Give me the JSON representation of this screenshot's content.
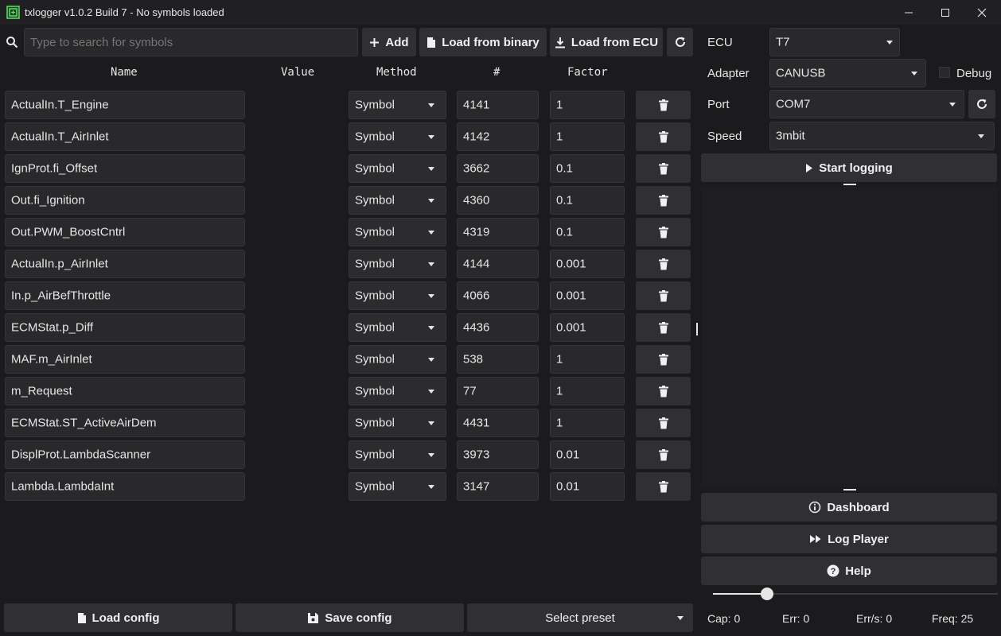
{
  "window": {
    "title": "txlogger v1.0.2 Build 7 - No symbols loaded"
  },
  "toolbar": {
    "search_placeholder": "Type to search for symbols",
    "add_label": "Add",
    "load_binary_label": "Load from binary",
    "load_ecu_label": "Load from ECU"
  },
  "table": {
    "headers": {
      "name": "Name",
      "value": "Value",
      "method": "Method",
      "number": "#",
      "factor": "Factor"
    },
    "rows": [
      {
        "name": "ActualIn.T_Engine",
        "value": "",
        "method": "Symbol",
        "number": "4141",
        "factor": "1"
      },
      {
        "name": "ActualIn.T_AirInlet",
        "value": "",
        "method": "Symbol",
        "number": "4142",
        "factor": "1"
      },
      {
        "name": "IgnProt.fi_Offset",
        "value": "",
        "method": "Symbol",
        "number": "3662",
        "factor": "0.1"
      },
      {
        "name": "Out.fi_Ignition",
        "value": "",
        "method": "Symbol",
        "number": "4360",
        "factor": "0.1"
      },
      {
        "name": "Out.PWM_BoostCntrl",
        "value": "",
        "method": "Symbol",
        "number": "4319",
        "factor": "0.1"
      },
      {
        "name": "ActualIn.p_AirInlet",
        "value": "",
        "method": "Symbol",
        "number": "4144",
        "factor": "0.001"
      },
      {
        "name": "In.p_AirBefThrottle",
        "value": "",
        "method": "Symbol",
        "number": "4066",
        "factor": "0.001"
      },
      {
        "name": "ECMStat.p_Diff",
        "value": "",
        "method": "Symbol",
        "number": "4436",
        "factor": "0.001"
      },
      {
        "name": "MAF.m_AirInlet",
        "value": "",
        "method": "Symbol",
        "number": "538",
        "factor": "1"
      },
      {
        "name": "m_Request",
        "value": "",
        "method": "Symbol",
        "number": "77",
        "factor": "1"
      },
      {
        "name": "ECMStat.ST_ActiveAirDem",
        "value": "",
        "method": "Symbol",
        "number": "4431",
        "factor": "1"
      },
      {
        "name": "DisplProt.LambdaScanner",
        "value": "",
        "method": "Symbol",
        "number": "3973",
        "factor": "0.01"
      },
      {
        "name": "Lambda.LambdaInt",
        "value": "",
        "method": "Symbol",
        "number": "3147",
        "factor": "0.01"
      }
    ]
  },
  "bottom": {
    "load_config_label": "Load config",
    "save_config_label": "Save config",
    "preset_label": "Select preset"
  },
  "settings": {
    "ecu_label": "ECU",
    "ecu_value": "T7",
    "adapter_label": "Adapter",
    "adapter_value": "CANUSB",
    "debug_label": "Debug",
    "port_label": "Port",
    "port_value": "COM7",
    "speed_label": "Speed",
    "speed_value": "3mbit",
    "start_label": "Start logging"
  },
  "nav": {
    "dashboard_label": "Dashboard",
    "logplayer_label": "Log Player",
    "help_label": "Help"
  },
  "slider": {
    "level": 0.19
  },
  "status": {
    "cap": "Cap: 0",
    "err": "Err: 0",
    "errs": "Err/s: 0",
    "freq": "Freq: 25"
  },
  "colors": {
    "background": "#1b1b1d",
    "control": "#29292c",
    "button": "#303034",
    "icon_green": "#5ee06a"
  }
}
